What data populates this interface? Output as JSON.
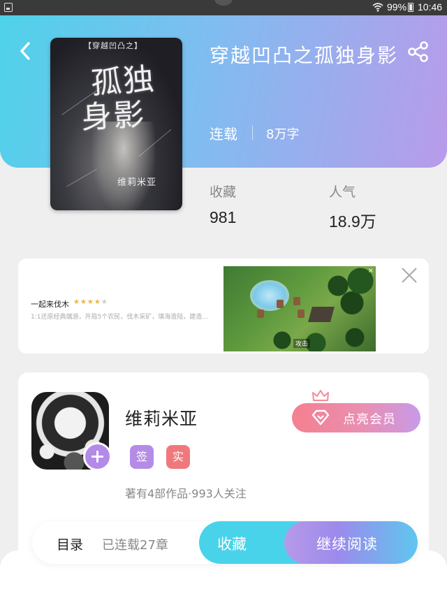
{
  "status_bar": {
    "battery": "99%",
    "time": "10:46"
  },
  "book": {
    "title": "穿越凹凸之孤独身影",
    "status": "连载",
    "word_count": "8万字",
    "cover": {
      "series": "【穿越凹凸之】",
      "title_line1": "孤独",
      "title_line2": "身影",
      "author": "维莉米亚"
    }
  },
  "stats": {
    "favorites_label": "收藏",
    "favorites_value": "981",
    "popularity_label": "人气",
    "popularity_value": "18.9万"
  },
  "ad": {
    "name": "一起来伐木",
    "rating": 4,
    "stars_filled": "★★★★",
    "stars_empty": "★",
    "description": "1:1还原经典端游，开局5个农民，伐木采矿，填海造陆，建造...",
    "image_label": "攻击",
    "mini_close": "×"
  },
  "author": {
    "name": "维莉米亚",
    "tag_signed": "签",
    "tag_verified": "实",
    "meta": "著有4部作品·993人关注",
    "vip_button": "点亮会员"
  },
  "bottom_bar": {
    "toc_label": "目录",
    "toc_count": "已连载27章",
    "collect_button": "收藏",
    "read_button": "继续阅读"
  },
  "colors": {
    "header_gradient_start": "#4fd2ea",
    "header_gradient_end": "#b89bea",
    "tag_signed": "#b48ce8",
    "tag_verified": "#f0787c",
    "collect": "#49d3ea"
  },
  "icons": {
    "back": "chevron-left-icon",
    "share": "share-icon",
    "close": "close-icon",
    "add": "plus-icon",
    "crown": "crown-icon",
    "diamond": "diamond-icon"
  }
}
